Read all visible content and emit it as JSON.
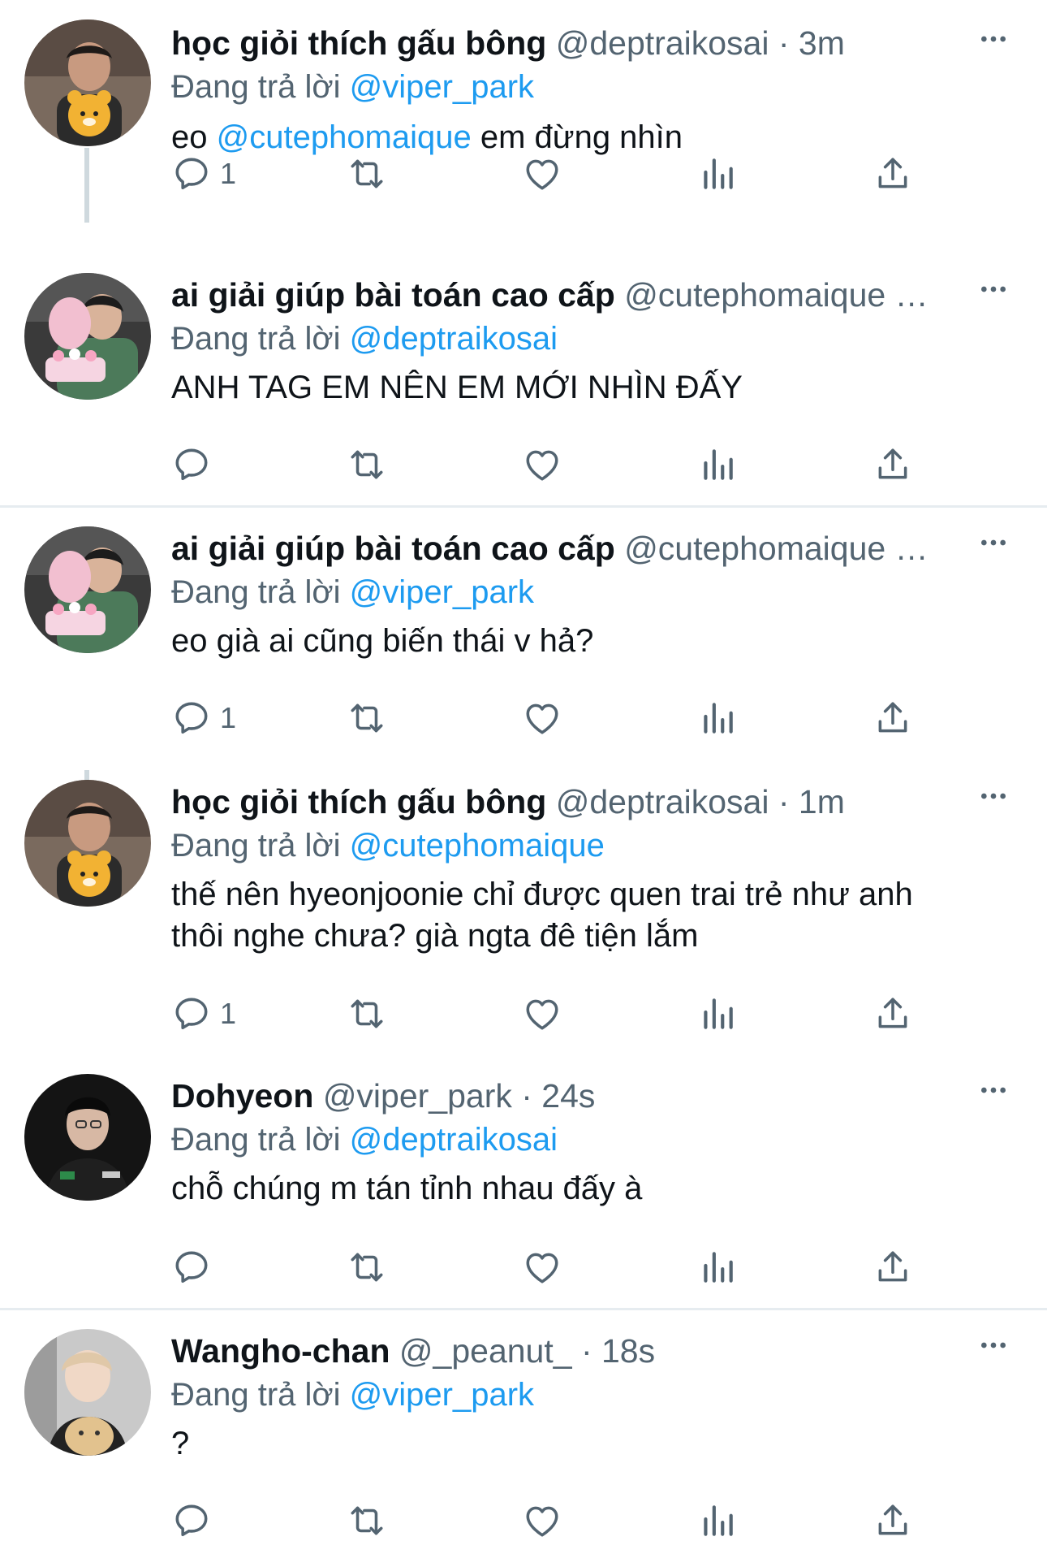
{
  "reply_prefix": "Đang trả lời",
  "tweets": [
    {
      "name": "học giỏi thích gấu bông",
      "handle": "@deptraikosai",
      "time": " · 3m",
      "reply_to": "@viper_park",
      "content_pre": "eo ",
      "mention": "@cutephomaique",
      "content_post": " em đừng nhìn",
      "reply_count": "1"
    },
    {
      "name": "ai giải giúp bài toán cao cấp",
      "handle": "@cutephomaique …",
      "time": "",
      "reply_to": "@deptraikosai",
      "content": "ANH TAG EM NÊN EM MỚI NHÌN ĐẤY",
      "reply_count": ""
    },
    {
      "name": "ai giải giúp bài toán cao cấp",
      "handle": "@cutephomaique …",
      "time": "",
      "reply_to": "@viper_park",
      "content": "eo già ai cũng biến thái v hả?",
      "reply_count": "1"
    },
    {
      "name": "học giỏi thích gấu bông",
      "handle": "@deptraikosai",
      "time": " · 1m",
      "reply_to": "@cutephomaique",
      "content_line1": "thế nên hyeonjoonie chỉ được quen trai trẻ như anh",
      "content_line2": "thôi nghe chưa? già ngta đê tiện lắm",
      "reply_count": "1"
    },
    {
      "name": "Dohyeon",
      "handle": "@viper_park",
      "time": " · 24s",
      "reply_to": "@deptraikosai",
      "content": "chỗ chúng m tán tỉnh nhau đấy à",
      "reply_count": ""
    },
    {
      "name": "Wangho-chan",
      "handle": "@_peanut_",
      "time": " · 18s",
      "reply_to": "@viper_park",
      "content": "?",
      "reply_count": ""
    }
  ],
  "icons": {
    "reply": "reply-icon",
    "retweet": "retweet-icon",
    "like": "heart-icon",
    "views": "views-icon",
    "share": "share-icon",
    "more": "more-icon"
  },
  "colors": {
    "link": "#1d9bf0",
    "secondary": "#536471",
    "divider": "#e6ecf0",
    "thread_line": "#cfd9de"
  }
}
